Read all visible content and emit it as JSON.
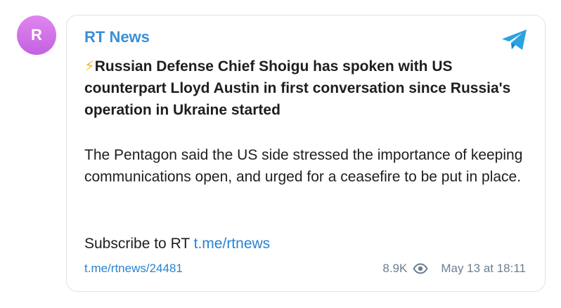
{
  "avatar": {
    "letter": "R",
    "color": "#d274ea"
  },
  "channel": {
    "name": "RT News",
    "name_color": "#3a8fd6"
  },
  "post": {
    "headline_emoji": "⚡",
    "headline": "Russian Defense Chief Shoigu has spoken with US counterpart Lloyd Austin in first conversation since Russia's operation in Ukraine started",
    "body": "The Pentagon said the US side stressed the importance of keeping communications open, and urged for a ceasefire to be put in place.",
    "subscribe_prefix": "Subscribe to RT ",
    "subscribe_link": "t.me/rtnews",
    "permalink": "t.me/rtnews/24481",
    "views": "8.9K",
    "date": "May 13 at 18:11"
  },
  "icons": {
    "telegram": "telegram-plane-icon",
    "views": "eye-icon"
  },
  "colors": {
    "link": "#2a82cf",
    "meta": "#6d7f92",
    "telegram": "#2aa3e0"
  }
}
